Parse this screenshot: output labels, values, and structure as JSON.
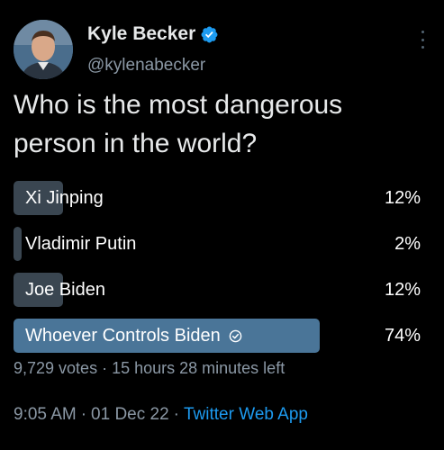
{
  "author": {
    "display_name": "Kyle Becker",
    "handle": "@kylenabecker",
    "verified_icon": "verified-badge-icon"
  },
  "tweet": {
    "text_line1": "Who is the most dangerous",
    "text_line2": "person in the world?"
  },
  "poll": {
    "options": [
      {
        "label": "Xi Jinping",
        "percent_label": "12%",
        "percent": 12,
        "winner": false
      },
      {
        "label": "Vladimir Putin",
        "percent_label": "2%",
        "percent": 2,
        "winner": false
      },
      {
        "label": "Joe Biden",
        "percent_label": "12%",
        "percent": 12,
        "winner": false
      },
      {
        "label": "Whoever Controls Biden",
        "percent_label": "74%",
        "percent": 74,
        "winner": true
      }
    ],
    "votes": "9,729 votes",
    "separator": "·",
    "time_left": "15 hours 28 minutes left"
  },
  "meta": {
    "time": "9:05 AM",
    "dot": "·",
    "date": "01 Dec 22",
    "source": "Twitter Web App"
  },
  "colors": {
    "background": "#000000",
    "bar": "#3a4651",
    "winner_bar": "#4a7598",
    "secondary_text": "#8b98a5",
    "link": "#1d9bf0",
    "verified": "#1d9bf0"
  }
}
